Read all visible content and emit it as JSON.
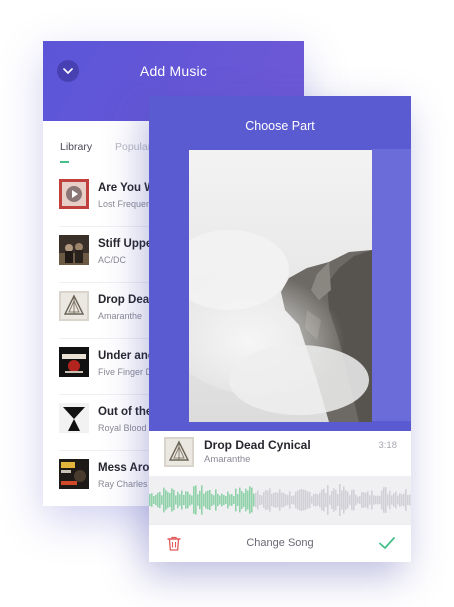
{
  "add_music": {
    "title": "Add Music",
    "tabs": [
      {
        "label": "Library",
        "active": true
      },
      {
        "label": "Popular",
        "active": false
      }
    ],
    "tracks": [
      {
        "title": "Are You With Me",
        "artist": "Lost Frequencies",
        "cover": "play-cover"
      },
      {
        "title": "Stiff Upper Lip",
        "artist": "AC/DC",
        "cover": "band-photo-cover"
      },
      {
        "title": "Drop Dead Cynical",
        "artist": "Amaranthe",
        "cover": "amaranthe-logo-cover"
      },
      {
        "title": "Under and Over It",
        "artist": "Five Finger Death Punch",
        "cover": "red-logo-cover"
      },
      {
        "title": "Out of the Black",
        "artist": "Royal Blood",
        "cover": "silhouette-cover"
      },
      {
        "title": "Mess Around",
        "artist": "Ray Charles",
        "cover": "vintage-poster-cover"
      }
    ]
  },
  "choose_part": {
    "title": "Choose Part",
    "now_playing": {
      "title": "Drop Dead Cynical",
      "artist": "Amaranthe",
      "duration": "3:18"
    },
    "selection_fraction": 0.4,
    "colors": {
      "accent": "#5a5bd0",
      "selected_wave": "#8fd1a8",
      "unselected_wave": "#d0d0d6",
      "confirm": "#46c08a"
    },
    "actions": {
      "change_song_label": "Change Song"
    },
    "icons": [
      "trash-icon",
      "checkmark-icon"
    ]
  }
}
